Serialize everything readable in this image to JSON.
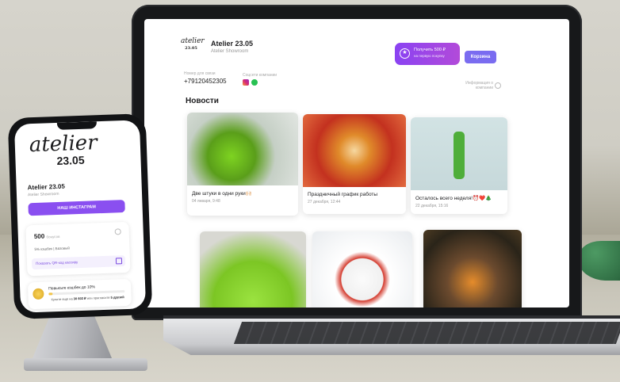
{
  "laptop_site": {
    "logo_script": "atelier",
    "logo_number": "23.05",
    "brand": "Atelier 23.05",
    "subtitle": "Atelier Showroom",
    "bonus_button": {
      "line1": "Получить 500 ₽",
      "line2": "на первую покупку"
    },
    "cart_button": "Корзина",
    "contacts": {
      "phone_label": "Номер для связи",
      "phone": "+79120452305",
      "social_label": "Соцсети компании"
    },
    "info_label": "Информация о компании",
    "news_title": "Новости",
    "news": [
      {
        "title": "Две штуки в одни руки🙌🏻",
        "date": "04 января, 9:48"
      },
      {
        "title": "Праздничный график работы",
        "date": "27 декабря, 12:44"
      },
      {
        "title": "Осталось всего неделя!⏰❤️🎄",
        "date": "22 декабря, 15:16"
      },
      {
        "title": "",
        "date": ""
      },
      {
        "title": "",
        "date": ""
      },
      {
        "title": "",
        "date": ""
      }
    ]
  },
  "phone_app": {
    "logo_script": "atelier",
    "logo_number": "23.05",
    "brand": "Atelier 23.05",
    "subtitle": "Atelier Showroom",
    "instagram_button": "НАШ ИНСТАГРАМ",
    "balance": "500",
    "balance_unit": "бонусов",
    "cashback": "5% кэшбек | Базовый",
    "qr_label": "Показать QR-код кассиру",
    "level": {
      "title": "Повысьте кэшбек до 10%",
      "progress": 0.05,
      "note_prefix": "Купите еще на",
      "note_amount": "30 603 ₽",
      "note_middle": "или пригласите",
      "note_friends": "5 друзей"
    }
  },
  "colors": {
    "accent_purple": "#8a4ff0",
    "cart_blue": "#7a6cf0",
    "whatsapp": "#28c152"
  }
}
